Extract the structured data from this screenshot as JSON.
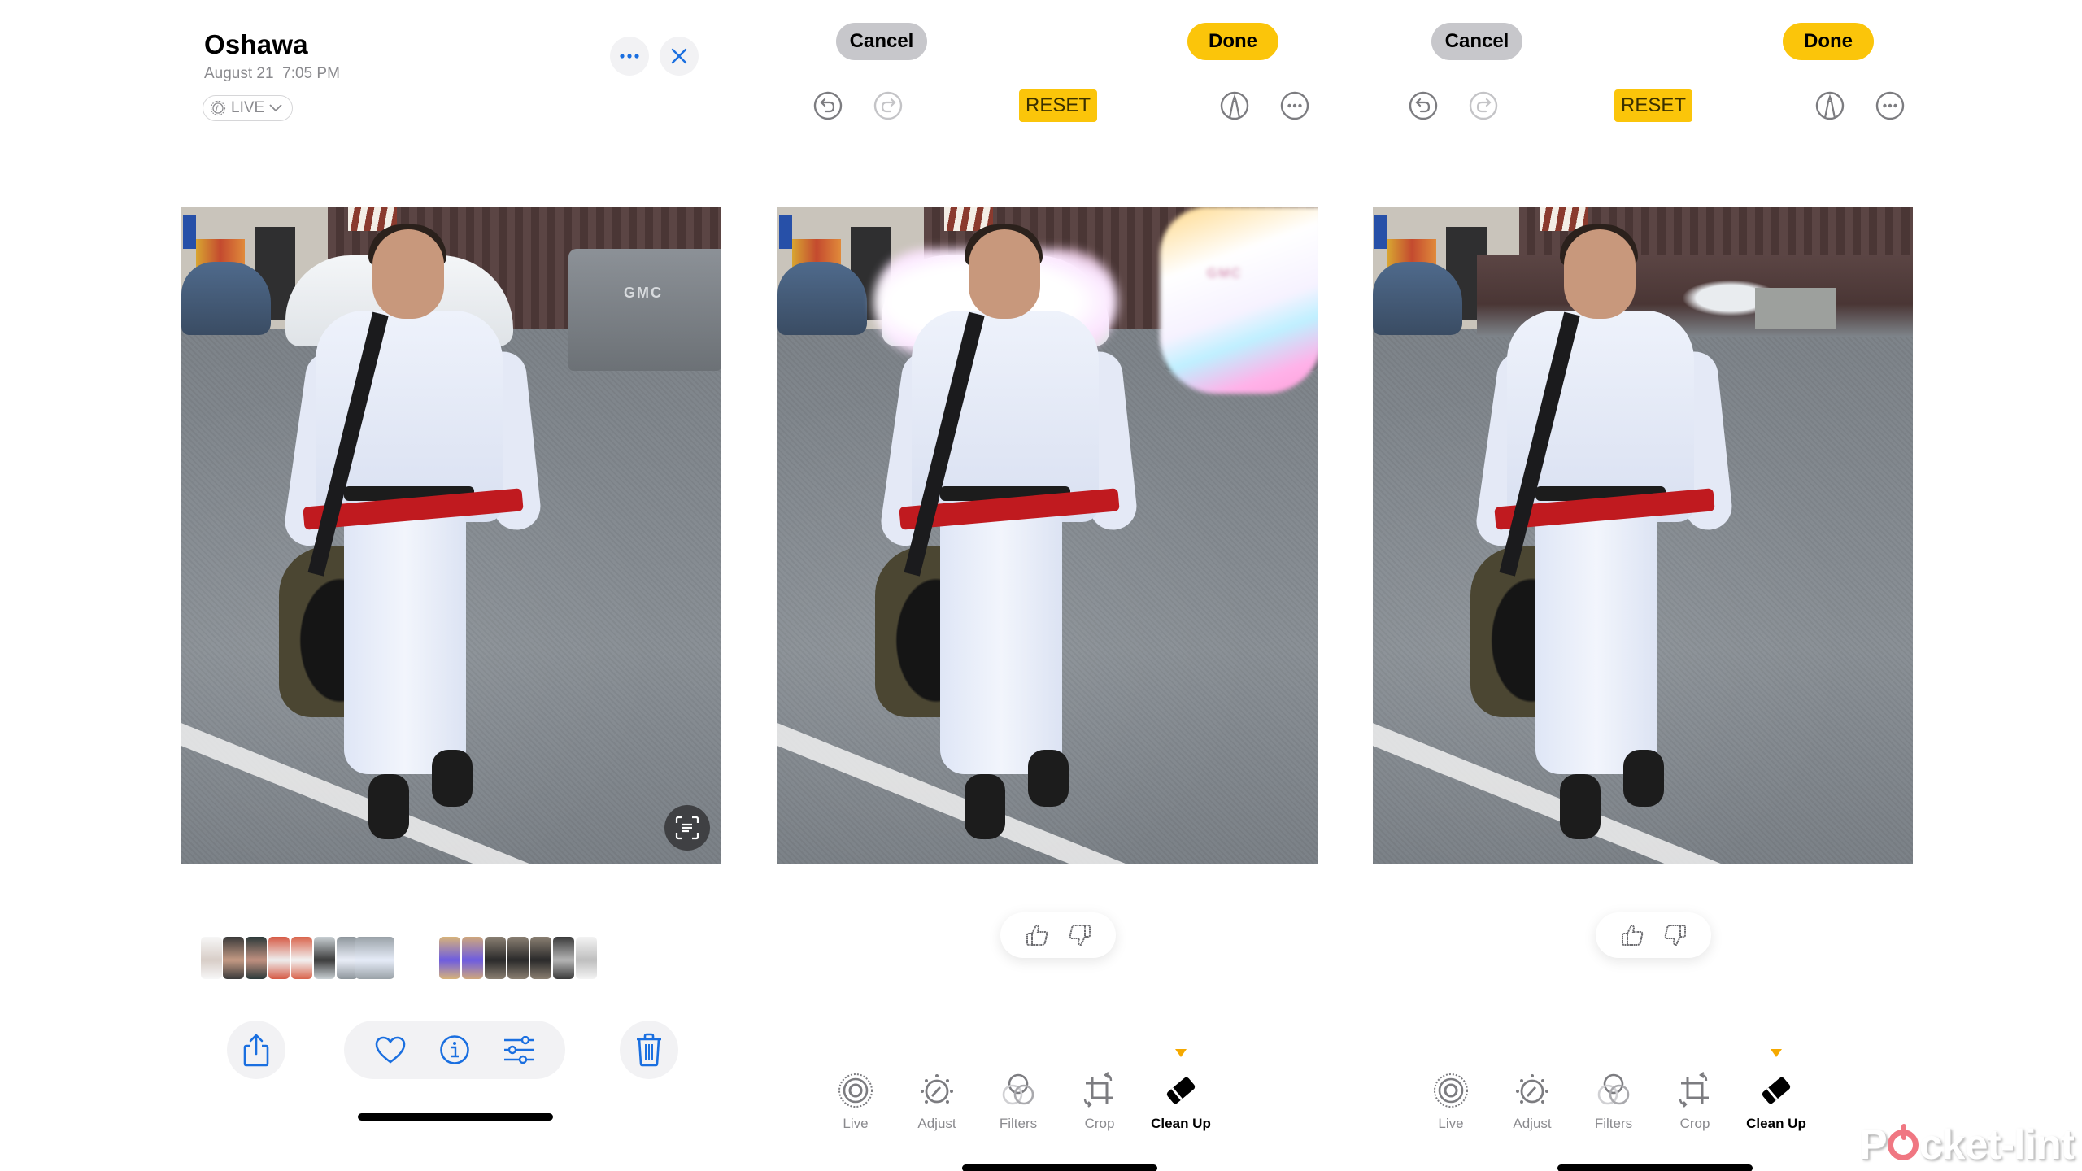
{
  "panel_view": {
    "header": {
      "title": "Oshawa",
      "date": "August 21",
      "time": "7:05 PM",
      "live_label": "LIVE",
      "more_icon": "ellipsis-icon",
      "close_icon": "close-icon"
    },
    "photo_overlay": {
      "live_text_icon": "live-text-icon"
    },
    "thumbnail_count": 15,
    "actions": {
      "share_icon": "share-icon",
      "favorite_icon": "heart-icon",
      "info_icon": "info-icon",
      "adjust_icon": "sliders-icon",
      "delete_icon": "trash-icon"
    }
  },
  "edit_panels": [
    {
      "state": "cleanup-selection-highlighted",
      "cancel_label": "Cancel",
      "done_label": "Done",
      "reset_label": "RESET",
      "feedback": {
        "thumbs_up_icon": "thumbs-up-icon",
        "thumbs_down_icon": "thumbs-down-icon"
      },
      "tabs": [
        {
          "label": "Live",
          "icon": "live-photo-icon",
          "active": false
        },
        {
          "label": "Adjust",
          "icon": "adjust-dial-icon",
          "active": false
        },
        {
          "label": "Filters",
          "icon": "filters-icon",
          "active": false
        },
        {
          "label": "Crop",
          "icon": "crop-rotate-icon",
          "active": false
        },
        {
          "label": "Clean Up",
          "icon": "eraser-icon",
          "active": true
        }
      ],
      "highlighted_text": "GMC"
    },
    {
      "state": "cleanup-result",
      "cancel_label": "Cancel",
      "done_label": "Done",
      "reset_label": "RESET",
      "feedback": {
        "thumbs_up_icon": "thumbs-up-icon",
        "thumbs_down_icon": "thumbs-down-icon"
      },
      "tabs": [
        {
          "label": "Live",
          "icon": "live-photo-icon",
          "active": false
        },
        {
          "label": "Adjust",
          "icon": "adjust-dial-icon",
          "active": false
        },
        {
          "label": "Filters",
          "icon": "filters-icon",
          "active": false
        },
        {
          "label": "Crop",
          "icon": "crop-rotate-icon",
          "active": false
        },
        {
          "label": "Clean Up",
          "icon": "eraser-icon",
          "active": true
        }
      ]
    }
  ],
  "photo": {
    "truck_brand": "GMC"
  },
  "watermark": {
    "before": "P",
    "after": "cket-lint"
  },
  "colors": {
    "accent_blue": "#1a6fe0",
    "done_yellow": "#fbc50a",
    "active_indicator": "#f5a900",
    "cancel_gray": "#c7c7cb",
    "icon_gray": "#7c7c80",
    "watermark_red": "#f07782"
  }
}
